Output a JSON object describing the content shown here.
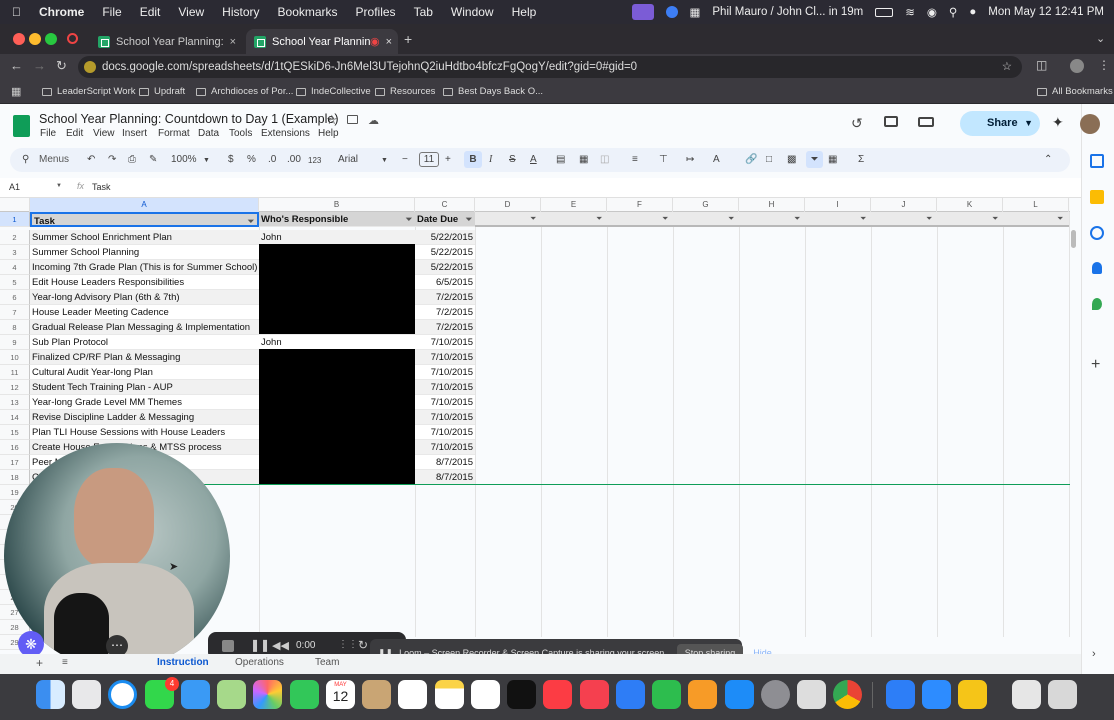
{
  "mac": {
    "menu": [
      "Chrome",
      "File",
      "Edit",
      "View",
      "History",
      "Bookmarks",
      "Profiles",
      "Tab",
      "Window",
      "Help"
    ],
    "meeting": "Phil Mauro / John Cl... in 19m",
    "date": "Mon May 12  12:41 PM"
  },
  "tabs": [
    "School Year Planning: Countd",
    "School Year Planning: Co"
  ],
  "url": "docs.google.com/spreadsheets/d/1tQESkiD6-Jn6Mel3UTejohnQ2iuHdtbo4bfczFgQogY/edit?gid=0#gid=0",
  "bookmarks": [
    "LeaderScript Work",
    "Updraft",
    "Archdioces of Por...",
    "IndeCollective",
    "Resources",
    "Best Days Back O...",
    "All Bookmarks"
  ],
  "doc": {
    "title": "School Year Planning: Countdown to Day 1 (Example)",
    "menus": [
      "File",
      "Edit",
      "View",
      "Insert",
      "Format",
      "Data",
      "Tools",
      "Extensions",
      "Help"
    ],
    "share": "Share"
  },
  "toolbar": {
    "search": "Menus",
    "zoom": "100%",
    "currency": "$",
    "percent": "%",
    "dec1": ".0",
    "dec2": ".00",
    "num": "123",
    "font": "Arial",
    "size": "11"
  },
  "formula": {
    "ref": "A1",
    "value": "Task"
  },
  "columns": [
    "A",
    "B",
    "C",
    "D",
    "E",
    "F",
    "G",
    "H",
    "I",
    "J",
    "K",
    "L"
  ],
  "headers": {
    "task": "Task",
    "who": "Who's Responsible",
    "due": "Date Due"
  },
  "rows": [
    {
      "n": "2",
      "task": "Summer School Enrichment Plan",
      "who": "John",
      "due": "5/22/2015"
    },
    {
      "n": "3",
      "task": "Summer School Planning",
      "who": "",
      "due": "5/22/2015"
    },
    {
      "n": "4",
      "task": "Incoming 7th Grade Plan (This is for Summer School)",
      "who": "",
      "due": "5/22/2015"
    },
    {
      "n": "5",
      "task": "Edit House Leaders Responsibilities",
      "who": "",
      "due": "6/5/2015"
    },
    {
      "n": "6",
      "task": "Year-long Advisory Plan (6th & 7th)",
      "who": "",
      "due": "7/2/2015"
    },
    {
      "n": "7",
      "task": "House Leader Meeting Cadence",
      "who": "",
      "due": "7/2/2015"
    },
    {
      "n": "8",
      "task": "Gradual Release Plan Messaging & Implementation",
      "who": "",
      "due": "7/2/2015"
    },
    {
      "n": "9",
      "task": "Sub Plan Protocol",
      "who": "John",
      "due": "7/10/2015"
    },
    {
      "n": "10",
      "task": "Finalized CP/RF Plan & Messaging",
      "who": "",
      "due": "7/10/2015"
    },
    {
      "n": "11",
      "task": "Cultural Audit Year-long Plan",
      "who": "",
      "due": "7/10/2015"
    },
    {
      "n": "12",
      "task": "Student Tech Training Plan - AUP",
      "who": "",
      "due": "7/10/2015"
    },
    {
      "n": "13",
      "task": "Year-long Grade Level MM Themes",
      "who": "",
      "due": "7/10/2015"
    },
    {
      "n": "14",
      "task": "Revise Discipline Ladder & Messaging",
      "who": "",
      "due": "7/10/2015"
    },
    {
      "n": "15",
      "task": "Plan TLI House Sessions with House Leaders",
      "who": "",
      "due": "7/10/2015"
    },
    {
      "n": "16",
      "task": "Create House Expectations & MTSS process",
      "who": "",
      "due": "7/10/2015"
    },
    {
      "n": "17",
      "task": "Peer M",
      "who": "",
      "due": "8/7/2015"
    },
    {
      "n": "18",
      "task": "Cl",
      "who": "",
      "due": "8/7/2015"
    }
  ],
  "extra_rows": [
    "19",
    "20",
    "21",
    "22",
    "23",
    "24",
    "25",
    "26",
    "27",
    "28",
    "29"
  ],
  "loom": {
    "time": "0:00",
    "note": "Loom – Screen Recorder & Screen Capture is sharing your screen.",
    "stop": "Stop sharing",
    "hide": "Hide"
  },
  "sheet_tabs": [
    "Instruction",
    "Operations",
    "Team"
  ],
  "dock": {
    "calendar_month": "MAY",
    "calendar_day": "12",
    "badge": "4"
  },
  "colors": {
    "sheets_green": "#0f9d58",
    "header_gray": "#d5d5d5",
    "chrome_dark": "#2d2b30"
  }
}
